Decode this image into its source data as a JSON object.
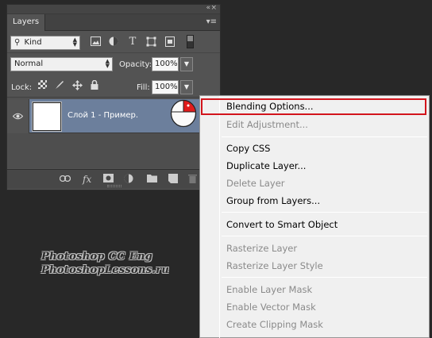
{
  "panel": {
    "tab_label": "Layers",
    "collapse_glyph": "«",
    "close_glyph": "×",
    "menu_glyph": "▾≡"
  },
  "filter": {
    "kind_label": "Kind",
    "search_glyph": "⚲",
    "icons": [
      "image-filter-icon",
      "adjustment-filter-icon",
      "type-filter-icon",
      "shape-filter-icon",
      "smart-object-filter-icon"
    ]
  },
  "blend": {
    "mode": "Normal",
    "opacity_label": "Opacity:",
    "opacity_value": "100%"
  },
  "lock": {
    "label": "Lock:",
    "fill_label": "Fill:",
    "fill_value": "100%"
  },
  "layer": {
    "name": "Слой 1 - Пример."
  },
  "bottom_icons": [
    "link-icon",
    "fx-icon",
    "mask-icon",
    "adjustment-icon",
    "group-folder-icon",
    "new-layer-icon",
    "trash-icon"
  ],
  "bottom_fx_label": "fx",
  "context_menu": {
    "items": [
      {
        "label": "Blending Options...",
        "enabled": true
      },
      {
        "label": "Edit Adjustment...",
        "enabled": false
      },
      {
        "label": "Copy CSS",
        "enabled": true
      },
      {
        "label": "Duplicate Layer...",
        "enabled": true
      },
      {
        "label": "Delete Layer",
        "enabled": false
      },
      {
        "label": "Group from Layers...",
        "enabled": true
      },
      {
        "label": "Convert to Smart Object",
        "enabled": true
      },
      {
        "label": "Rasterize Layer",
        "enabled": false
      },
      {
        "label": "Rasterize Layer Style",
        "enabled": false
      },
      {
        "label": "Enable Layer Mask",
        "enabled": false
      },
      {
        "label": "Enable Vector Mask",
        "enabled": false
      },
      {
        "label": "Create Clipping Mask",
        "enabled": false
      }
    ],
    "highlight_color": "#d2141c"
  },
  "watermark": {
    "line1": "Photoshop  CC  Eng",
    "line2": "PhotoshopLessons.ru"
  },
  "colors": {
    "selected_layer": "#6c7f9c",
    "panel_bg": "#535353",
    "app_bg": "#282828"
  }
}
